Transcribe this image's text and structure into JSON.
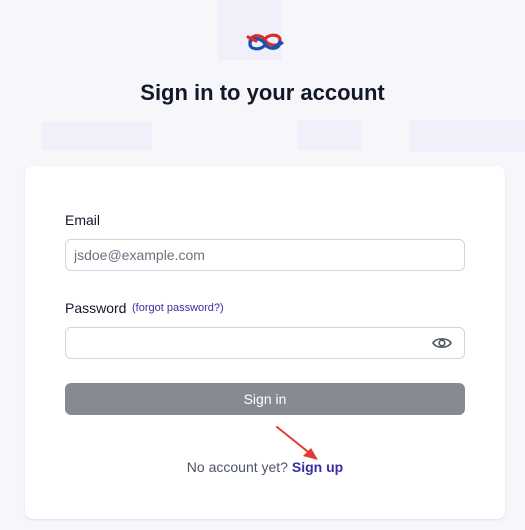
{
  "header": {
    "title": "Sign in to your account"
  },
  "form": {
    "email_label": "Email",
    "email_placeholder": "jsdoe@example.com",
    "email_value": "",
    "password_label": "Password",
    "forgot_password_link": "(forgot password?)",
    "password_value": "",
    "show_password_icon": "eye-icon",
    "submit_label": "Sign in"
  },
  "footer": {
    "prompt": "No account yet?",
    "signup_link": "Sign up"
  },
  "colors": {
    "accent": "#3730a3",
    "button_bg": "#868b93",
    "annotation_arrow": "#e53935"
  }
}
